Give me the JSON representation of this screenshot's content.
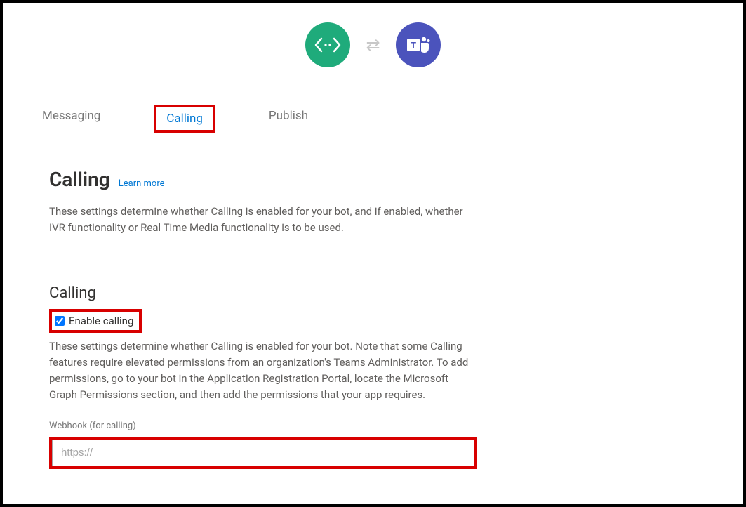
{
  "tabs": {
    "messaging": "Messaging",
    "calling": "Calling",
    "publish": "Publish"
  },
  "section": {
    "title": "Calling",
    "learn_more": "Learn more",
    "description": "These settings determine whether Calling is enabled for your bot, and if enabled, whether IVR functionality or Real Time Media functionality is to be used."
  },
  "calling_block": {
    "title": "Calling",
    "enable_label": "Enable calling",
    "enable_checked": true,
    "description": "These settings determine whether Calling is enabled for your bot. Note that some Calling features require elevated permissions from an organization's Teams Administrator. To add permissions, go to your bot in the Application Registration Portal, locate the Microsoft Graph Permissions section, and then add the permissions that your app requires.",
    "webhook_label": "Webhook (for calling)",
    "webhook_placeholder": "https://",
    "webhook_value": ""
  },
  "icons": {
    "bot": "code-bot-icon",
    "swap": "swap-arrows-icon",
    "teams": "microsoft-teams-icon"
  }
}
